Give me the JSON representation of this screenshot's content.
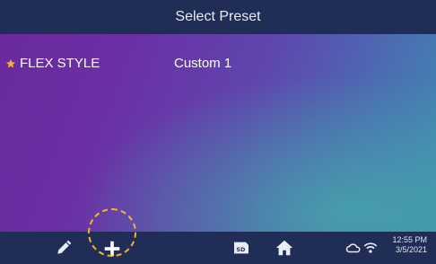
{
  "header": {
    "title": "Select Preset"
  },
  "presets": [
    {
      "favorite_icon": "star-icon",
      "name": "FLEX STYLE",
      "value": "Custom 1"
    }
  ],
  "toolbar": {
    "icons": [
      "pencil-icon",
      "plus-icon",
      "sd-card-icon",
      "home-icon",
      "cloud-icon",
      "wifi-icon"
    ],
    "time": "12:55 PM",
    "date": "3/5/2021"
  },
  "colors": {
    "bar": "#1f2d57",
    "accent": "#f1b52a",
    "text": "#ffffff"
  }
}
